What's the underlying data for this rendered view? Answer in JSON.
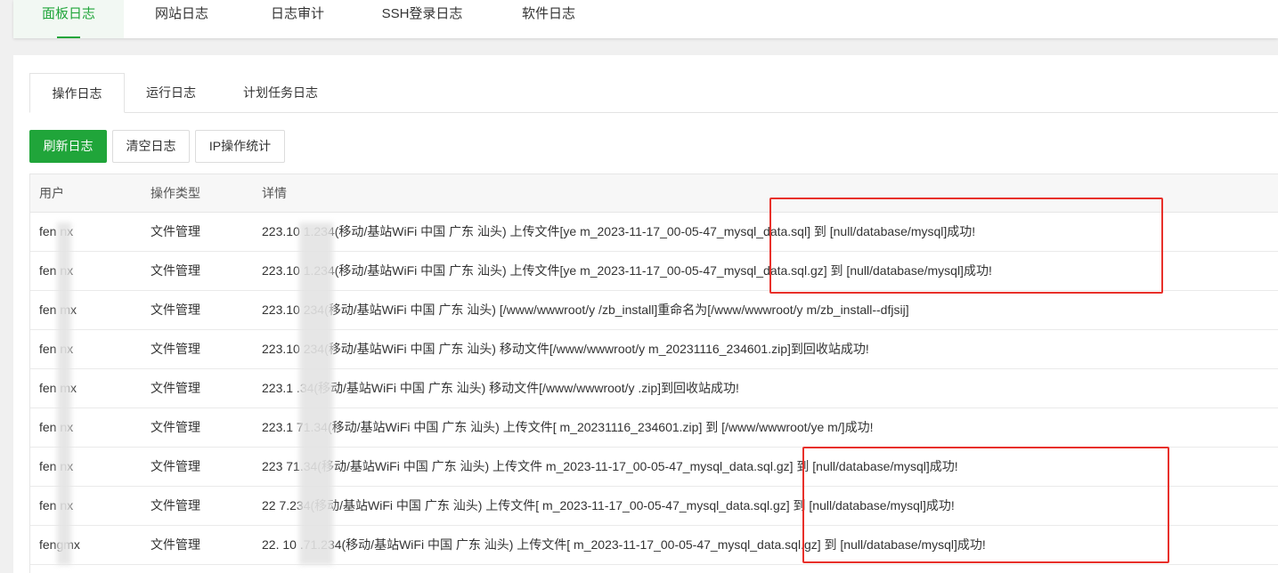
{
  "top_tabs": [
    {
      "label": "面板日志",
      "active": true
    },
    {
      "label": "网站日志"
    },
    {
      "label": "日志审计"
    },
    {
      "label": "SSH登录日志"
    },
    {
      "label": "软件日志"
    }
  ],
  "sub_tabs": [
    {
      "label": "操作日志",
      "active": true
    },
    {
      "label": "运行日志"
    },
    {
      "label": "计划任务日志"
    }
  ],
  "buttons": {
    "refresh": "刷新日志",
    "clear": "清空日志",
    "ip_stats": "IP操作统计"
  },
  "table": {
    "headers": [
      "用户",
      "操作类型",
      "详情"
    ],
    "rows": [
      {
        "user": "fen  nx",
        "type": "文件管理",
        "detail": "223.10     1.234(移动/基站WiFi 中国 广东 汕头) 上传文件[ye       m_2023-11-17_00-05-47_mysql_data.sql] 到 [null/database/mysql]成功!"
      },
      {
        "user": "fen  nx",
        "type": "文件管理",
        "detail": "223.10     1.234(移动/基站WiFi 中国 广东 汕头) 上传文件[ye       m_2023-11-17_00-05-47_mysql_data.sql.gz] 到 [null/database/mysql]成功!"
      },
      {
        "user": "fen  mx",
        "type": "文件管理",
        "detail": "223.10     234(移动/基站WiFi 中国 广东 汕头) [/www/wwwroot/y         /zb_install]重命名为[/www/wwwroot/y            m/zb_install--dfjsij]"
      },
      {
        "user": "fen  nx",
        "type": "文件管理",
        "detail": "223.10     234(移动/基站WiFi 中国 广东 汕头) 移动文件[/www/wwwroot/y                        m_20231116_234601.zip]到回收站成功!"
      },
      {
        "user": "fen  mx",
        "type": "文件管理",
        "detail": "223.1      .34(移动/基站WiFi 中国 广东 汕头) 移动文件[/www/wwwroot/y                   .zip]到回收站成功!"
      },
      {
        "user": "fen  nx",
        "type": "文件管理",
        "detail": "223.1     71.34(移动/基站WiFi 中国 广东 汕头) 上传文件[         m_20231116_234601.zip] 到 [/www/wwwroot/ye          m/]成功!"
      },
      {
        "user": "fen  nx",
        "type": "文件管理",
        "detail": "223     71.34(移动/基站WiFi 中国 广东 汕头) 上传文件           m_2023-11-17_00-05-47_mysql_data.sql.gz] 到 [null/database/mysql]成功!"
      },
      {
        "user": "fen  nx",
        "type": "文件管理",
        "detail": "22    7.234(移动/基站WiFi 中国 广东 汕头) 上传文件[         m_2023-11-17_00-05-47_mysql_data.sql.gz] 到 [null/database/mysql]成功!"
      },
      {
        "user": "fengmx",
        "type": "文件管理",
        "detail": "22.   10 .71.234(移动/基站WiFi 中国 广东 汕头) 上传文件[        m_2023-11-17_00-05-47_mysql_data.sql.gz] 到 [null/database/mysql]成功!"
      }
    ]
  },
  "colors": {
    "accent": "#20a53a",
    "highlight_box": "#e8302a"
  }
}
